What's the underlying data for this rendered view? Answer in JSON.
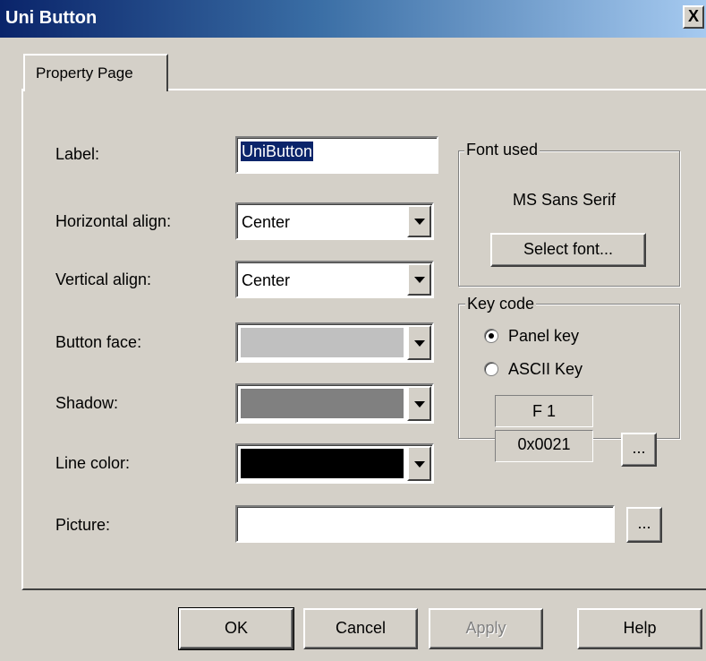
{
  "window": {
    "title": "Uni Button",
    "close_glyph": "X"
  },
  "tabs": [
    {
      "label": "Property Page"
    }
  ],
  "form": {
    "label": {
      "caption": "Label:",
      "value": "UniButton"
    },
    "horizontal_align": {
      "caption": "Horizontal align:",
      "value": "Center"
    },
    "vertical_align": {
      "caption": "Vertical align:",
      "value": "Center"
    },
    "button_face": {
      "caption": "Button face:",
      "color": "#c0c0c0"
    },
    "shadow": {
      "caption": "Shadow:",
      "color": "#808080"
    },
    "line_color": {
      "caption": "Line color:",
      "color": "#000000"
    },
    "picture": {
      "caption": "Picture:",
      "value": "",
      "browse_label": "..."
    }
  },
  "font_group": {
    "title": "Font used",
    "font_name": "MS Sans Serif",
    "select_button": "Select font..."
  },
  "key_group": {
    "title": "Key code",
    "options": [
      {
        "label": "Panel key",
        "checked": true
      },
      {
        "label": "ASCII Key",
        "checked": false
      }
    ],
    "key_name": "F 1",
    "key_code": "0x0021",
    "browse_label": "..."
  },
  "buttons": {
    "ok": "OK",
    "cancel": "Cancel",
    "apply": "Apply",
    "help": "Help"
  }
}
